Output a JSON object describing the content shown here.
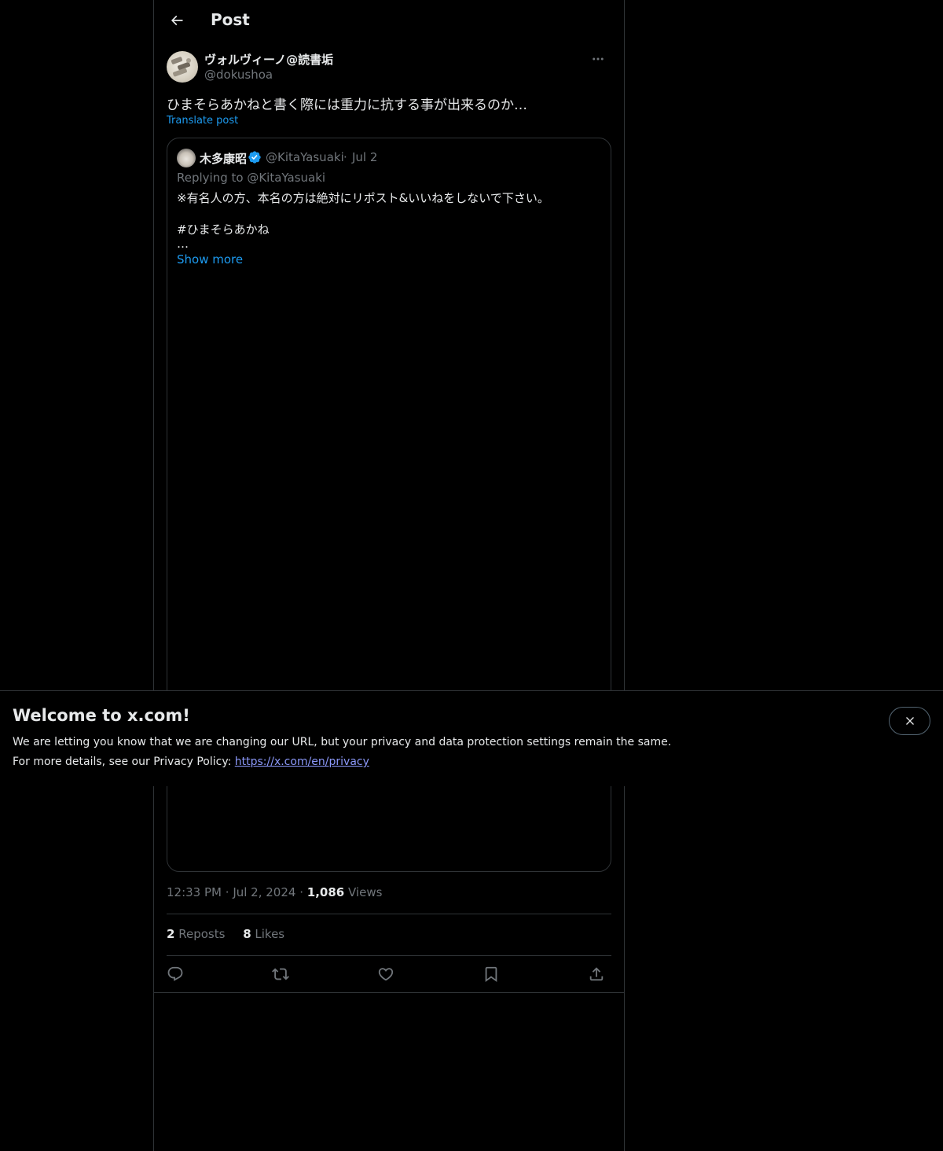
{
  "header": {
    "title": "Post"
  },
  "post": {
    "author_name": "ヴォルヴィーノ@読書垢",
    "author_handle": "@dokushoa",
    "text": "ひまそらあかねと書く際には重力に抗する事が出来るのか…",
    "translate_label": "Translate post",
    "time": "12:33 PM",
    "date": "Jul 2, 2024",
    "views_count": "1,086",
    "views_label": "Views",
    "reposts_count": "2",
    "reposts_label": "Reposts",
    "likes_count": "8",
    "likes_label": "Likes"
  },
  "quote": {
    "author_name": "木多康昭",
    "author_handle": "@KitaYasuaki",
    "date": "Jul 2",
    "replying": "Replying to @KitaYasuaki",
    "line1": "※有名人の方、本名の方は絶対にリポスト&いいねをしないで下さい。",
    "line2": "#ひまそらあかね",
    "line3": "…",
    "show_more": "Show more"
  },
  "banner": {
    "title": "Welcome to x.com!",
    "text1": "We are letting you know that we are changing our URL, but your privacy and data protection settings remain the same.",
    "text2_prefix": "For more details, see our Privacy Policy: ",
    "link": "https://x.com/en/privacy"
  },
  "icons": {
    "back": "arrow-left-icon",
    "more": "more-horizontal-icon",
    "verified": "verified-badge-icon",
    "reply": "reply-icon",
    "repost": "repost-icon",
    "like": "heart-icon",
    "bookmark": "bookmark-icon",
    "share": "share-icon",
    "close": "close-icon"
  },
  "colors": {
    "background": "#000000",
    "text": "#e7e9ea",
    "secondary": "#71767b",
    "accent": "#1d9bf0",
    "border": "#2f3336",
    "link": "#8b98f9"
  }
}
